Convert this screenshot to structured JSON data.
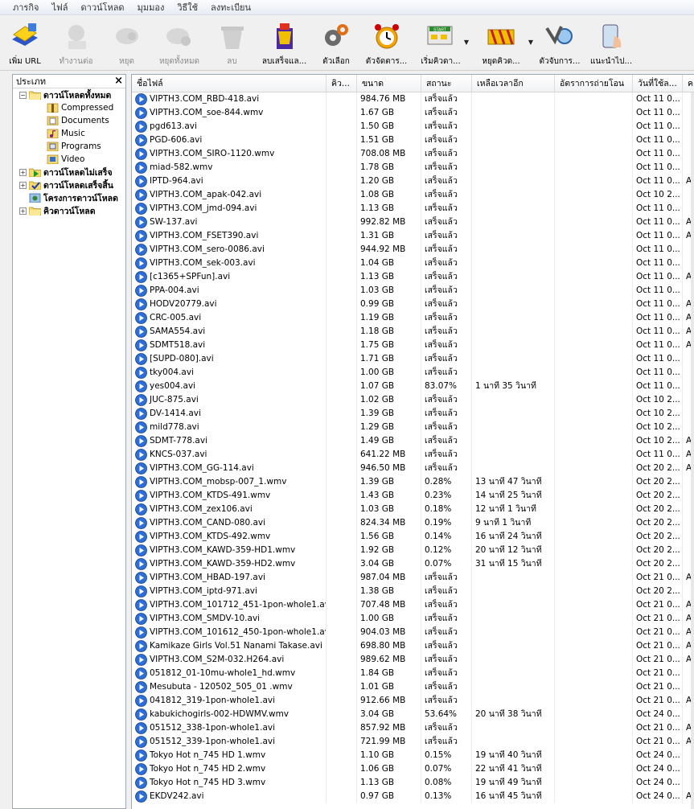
{
  "menu": [
    "ภารกิจ",
    "ไฟล์",
    "ดาวน์โหลด",
    "มุมมอง",
    "วิธีใช้",
    "ลงทะเบียน"
  ],
  "toolbar": [
    {
      "label": "เพิ่ม URL",
      "icon": "add-url-icon",
      "enabled": true,
      "dropdown": false
    },
    {
      "label": "ทำงานต่อ",
      "icon": "resume-icon",
      "enabled": false,
      "dropdown": false
    },
    {
      "label": "หยุด",
      "icon": "stop-icon",
      "enabled": false,
      "dropdown": false
    },
    {
      "label": "หยุดทั้งหมด",
      "icon": "stop-all-icon",
      "enabled": false,
      "dropdown": false
    },
    {
      "label": "ลบ",
      "icon": "delete-icon",
      "enabled": false,
      "dropdown": false
    },
    {
      "label": "ลบเสร็จแล...",
      "icon": "delete-completed-icon",
      "enabled": true,
      "dropdown": false
    },
    {
      "label": "ตัวเลือก",
      "icon": "options-icon",
      "enabled": true,
      "dropdown": false
    },
    {
      "label": "ตัวจัดตาร...",
      "icon": "scheduler-icon",
      "enabled": true,
      "dropdown": false
    },
    {
      "label": "เริ่มคิวดา...",
      "icon": "start-queue-icon",
      "enabled": true,
      "dropdown": true
    },
    {
      "label": "หยุดคิวด...",
      "icon": "stop-queue-icon",
      "enabled": true,
      "dropdown": true
    },
    {
      "label": "ตัวจับการ...",
      "icon": "grabber-icon",
      "enabled": true,
      "dropdown": false
    },
    {
      "label": "แนะนำไป...",
      "icon": "tell-friend-icon",
      "enabled": true,
      "dropdown": false
    }
  ],
  "tree": {
    "title": "ประเภท",
    "nodes": [
      {
        "label": "ดาวน์โหลดทั้งหมด",
        "level": 0,
        "toggle": "−",
        "bold": true,
        "icon": "folder-open-icon"
      },
      {
        "label": "Compressed",
        "level": 1,
        "toggle": "",
        "bold": false,
        "icon": "compressed-icon"
      },
      {
        "label": "Documents",
        "level": 1,
        "toggle": "",
        "bold": false,
        "icon": "documents-icon"
      },
      {
        "label": "Music",
        "level": 1,
        "toggle": "",
        "bold": false,
        "icon": "music-icon"
      },
      {
        "label": "Programs",
        "level": 1,
        "toggle": "",
        "bold": false,
        "icon": "programs-icon"
      },
      {
        "label": "Video",
        "level": 1,
        "toggle": "",
        "bold": false,
        "icon": "video-icon"
      },
      {
        "label": "ดาวน์โหลดไม่เสร็จ",
        "level": 0,
        "toggle": "+",
        "bold": true,
        "icon": "unfinished-icon"
      },
      {
        "label": "ดาวน์โหลดเสร็จสิ้น",
        "level": 0,
        "toggle": "+",
        "bold": true,
        "icon": "finished-icon"
      },
      {
        "label": "โครงการดาวน์โหลด",
        "level": 0,
        "toggle": "",
        "bold": true,
        "icon": "project-icon"
      },
      {
        "label": "คิวดาวน์โหลด",
        "level": 0,
        "toggle": "+",
        "bold": true,
        "icon": "queue-icon"
      }
    ]
  },
  "columns": [
    "ชื่อไฟล์",
    "คิว...",
    "ขนาด",
    "สถานะ",
    "เหลือเวลาอีก",
    "อัตราการถ่ายโอน",
    "วันที่ใช้ล...",
    "ค"
  ],
  "rows": [
    [
      "VIPTH3.COM_RBD-418.avi",
      "984.76  MB",
      "เสร็จแล้ว",
      "",
      "Oct 11 0...",
      ""
    ],
    [
      "VIPTH3.COM_soe-844.wmv",
      "1.67  GB",
      "เสร็จแล้ว",
      "",
      "Oct 11 0...",
      ""
    ],
    [
      "pgd613.avi",
      "1.50  GB",
      "เสร็จแล้ว",
      "",
      "Oct 11 0...",
      ""
    ],
    [
      "PGD-606.avi",
      "1.51  GB",
      "เสร็จแล้ว",
      "",
      "Oct 11 0...",
      ""
    ],
    [
      "VIPTH3.COM_SIRO-1120.wmv",
      "708.08  MB",
      "เสร็จแล้ว",
      "",
      "Oct 11 0...",
      ""
    ],
    [
      "miad-582.wmv",
      "1.78  GB",
      "เสร็จแล้ว",
      "",
      "Oct 11 0...",
      ""
    ],
    [
      "IPTD-964.avi",
      "1.20  GB",
      "เสร็จแล้ว",
      "",
      "Oct 11 0...",
      "A"
    ],
    [
      "VIPTH3.COM_apak-042.avi",
      "1.08  GB",
      "เสร็จแล้ว",
      "",
      "Oct 10 2...",
      ""
    ],
    [
      "VIPTH3.COM_jmd-094.avi",
      "1.13  GB",
      "เสร็จแล้ว",
      "",
      "Oct 11 0...",
      ""
    ],
    [
      "SW-137.avi",
      "992.82  MB",
      "เสร็จแล้ว",
      "",
      "Oct 11 0...",
      "A"
    ],
    [
      "VIPTH3.COM_FSET390.avi",
      "1.31  GB",
      "เสร็จแล้ว",
      "",
      "Oct 11 0...",
      "A"
    ],
    [
      "VIPTH3.COM_sero-0086.avi",
      "944.92  MB",
      "เสร็จแล้ว",
      "",
      "Oct 11 0...",
      ""
    ],
    [
      "VIPTH3.COM_sek-003.avi",
      "1.04  GB",
      "เสร็จแล้ว",
      "",
      "Oct 11 0...",
      ""
    ],
    [
      "[c1365+SPFun].avi",
      "1.13  GB",
      "เสร็จแล้ว",
      "",
      "Oct 11 0...",
      "A"
    ],
    [
      "PPA-004.avi",
      "1.03  GB",
      "เสร็จแล้ว",
      "",
      "Oct 11 0...",
      ""
    ],
    [
      "HODV20779.avi",
      "0.99  GB",
      "เสร็จแล้ว",
      "",
      "Oct 11 0...",
      "A"
    ],
    [
      "CRC-005.avi",
      "1.19  GB",
      "เสร็จแล้ว",
      "",
      "Oct 11 0...",
      "A"
    ],
    [
      "SAMA554.avi",
      "1.18  GB",
      "เสร็จแล้ว",
      "",
      "Oct 11 0...",
      "A"
    ],
    [
      "SDMT518.avi",
      "1.75  GB",
      "เสร็จแล้ว",
      "",
      "Oct 11 0...",
      "A"
    ],
    [
      "[SUPD-080].avi",
      "1.71  GB",
      "เสร็จแล้ว",
      "",
      "Oct 11 0...",
      ""
    ],
    [
      "tky004.avi",
      "1.00  GB",
      "เสร็จแล้ว",
      "",
      "Oct 11 0...",
      ""
    ],
    [
      "yes004.avi",
      "1.07  GB",
      "83.07%",
      "1 นาที 35 วินาที",
      "Oct 11 0...",
      ""
    ],
    [
      "JUC-875.avi",
      "1.02  GB",
      "เสร็จแล้ว",
      "",
      "Oct 10 2...",
      ""
    ],
    [
      "DV-1414.avi",
      "1.39  GB",
      "เสร็จแล้ว",
      "",
      "Oct 10 2...",
      ""
    ],
    [
      "mild778.avi",
      "1.29  GB",
      "เสร็จแล้ว",
      "",
      "Oct 10 2...",
      ""
    ],
    [
      "SDMT-778.avi",
      "1.49  GB",
      "เสร็จแล้ว",
      "",
      "Oct 10 2...",
      "A"
    ],
    [
      "KNCS-037.avi",
      "641.22  MB",
      "เสร็จแล้ว",
      "",
      "Oct 11 0...",
      "A"
    ],
    [
      "VIPTH3.COM_GG-114.avi",
      "946.50  MB",
      "เสร็จแล้ว",
      "",
      "Oct 20 2...",
      "A"
    ],
    [
      "VIPTH3.COM_mobsp-007_1.wmv",
      "1.39  GB",
      "0.28%",
      "13 นาที 47 วินาที",
      "Oct 20 2...",
      ""
    ],
    [
      "VIPTH3.COM_KTDS-491.wmv",
      "1.43  GB",
      "0.23%",
      "14 นาที 25 วินาที",
      "Oct 20 2...",
      ""
    ],
    [
      "VIPTH3.COM_zex106.avi",
      "1.03  GB",
      "0.18%",
      "12 นาที 1 วินาที",
      "Oct 20 2...",
      ""
    ],
    [
      "VIPTH3.COM_CAND-080.avi",
      "824.34  MB",
      "0.19%",
      "9 นาที 1 วินาที",
      "Oct 20 2...",
      ""
    ],
    [
      "VIPTH3.COM_KTDS-492.wmv",
      "1.56  GB",
      "0.14%",
      "16 นาที 24 วินาที",
      "Oct 20 2...",
      ""
    ],
    [
      "VIPTH3.COM_KAWD-359-HD1.wmv",
      "1.92  GB",
      "0.12%",
      "20 นาที 12 วินาที",
      "Oct 20 2...",
      ""
    ],
    [
      "VIPTH3.COM_KAWD-359-HD2.wmv",
      "3.04  GB",
      "0.07%",
      "31 นาที 15 วินาที",
      "Oct 20 2...",
      ""
    ],
    [
      "VIPTH3.COM_HBAD-197.avi",
      "987.04  MB",
      "เสร็จแล้ว",
      "",
      "Oct 21 0...",
      "A"
    ],
    [
      "VIPTH3.COM_iptd-971.avi",
      "1.38  GB",
      "เสร็จแล้ว",
      "",
      "Oct 20 2...",
      ""
    ],
    [
      "VIPTH3.COM_101712_451-1pon-whole1.avi",
      "707.48  MB",
      "เสร็จแล้ว",
      "",
      "Oct 21 0...",
      "A"
    ],
    [
      "VIPTH3.COM_SMDV-10.avi",
      "1.00  GB",
      "เสร็จแล้ว",
      "",
      "Oct 21 0...",
      "A"
    ],
    [
      "VIPTH3.COM_101612_450-1pon-whole1.avi",
      "904.03  MB",
      "เสร็จแล้ว",
      "",
      "Oct 21 0...",
      "A"
    ],
    [
      "Kamikaze Girls Vol.51 Nanami Takase.avi",
      "698.80  MB",
      "เสร็จแล้ว",
      "",
      "Oct 21 0...",
      "A"
    ],
    [
      "VIPTH3.COM_S2M-032.H264.avi",
      "989.62  MB",
      "เสร็จแล้ว",
      "",
      "Oct 21 0...",
      "A"
    ],
    [
      "051812_01-10mu-whole1_hd.wmv",
      "1.84  GB",
      "เสร็จแล้ว",
      "",
      "Oct 21 0...",
      ""
    ],
    [
      "Mesubuta - 120502_505_01 .wmv",
      "1.01  GB",
      "เสร็จแล้ว",
      "",
      "Oct 21 0...",
      ""
    ],
    [
      "041812_319-1pon-whole1.avi",
      "912.66  MB",
      "เสร็จแล้ว",
      "",
      "Oct 21 0...",
      "A"
    ],
    [
      "kabukichogirls-002-HDWMV.wmv",
      "3.04  GB",
      "53.64%",
      "20 นาที 38 วินาที",
      "Oct 24 0...",
      ""
    ],
    [
      "051512_338-1pon-whole1.avi",
      "857.92  MB",
      "เสร็จแล้ว",
      "",
      "Oct 21 0...",
      "A"
    ],
    [
      "051512_339-1pon-whole1.avi",
      "721.99  MB",
      "เสร็จแล้ว",
      "",
      "Oct 21 0...",
      "A"
    ],
    [
      "Tokyo Hot n_745 HD 1.wmv",
      "1.10  GB",
      "0.15%",
      "19 นาที 40 วินาที",
      "Oct 24 0...",
      ""
    ],
    [
      "Tokyo Hot n_745 HD 2.wmv",
      "1.06  GB",
      "0.07%",
      "22 นาที 41 วินาที",
      "Oct 24 0...",
      ""
    ],
    [
      "Tokyo Hot n_745 HD 3.wmv",
      "1.13  GB",
      "0.08%",
      "19 นาที 49 วินาที",
      "Oct 24 0...",
      ""
    ],
    [
      "EKDV242.avi",
      "0.97  GB",
      "0.13%",
      "16 นาที 45 วินาที",
      "Oct 24 0...",
      "A"
    ]
  ]
}
